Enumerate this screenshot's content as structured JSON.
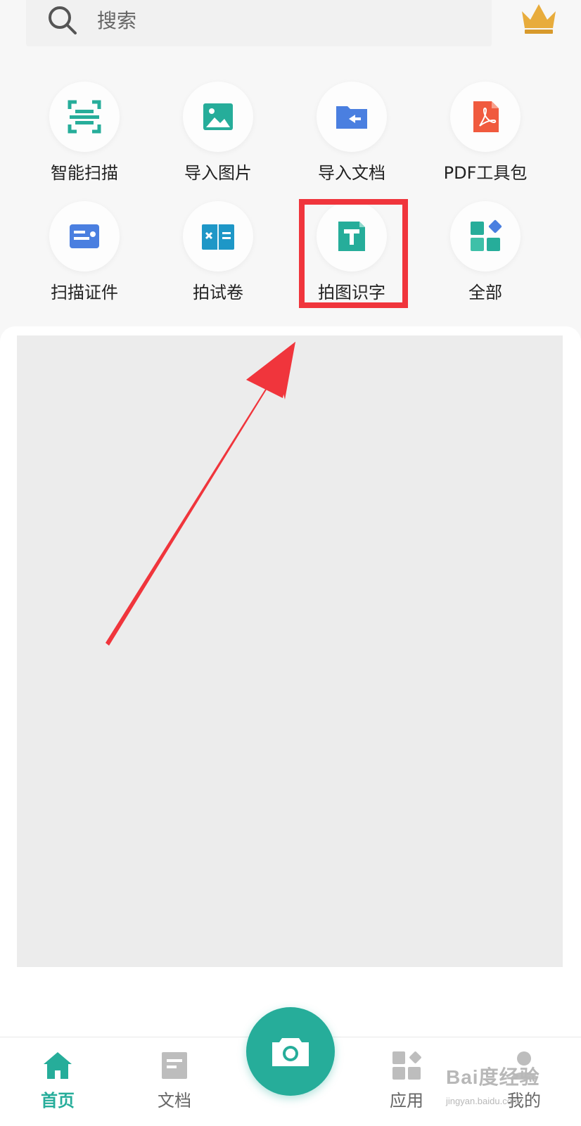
{
  "search": {
    "placeholder": "搜索"
  },
  "colors": {
    "accent": "#26ad9a",
    "highlight": "#f0353c"
  },
  "tools": [
    {
      "label": "智能扫描",
      "icon": "smart-scan-icon"
    },
    {
      "label": "导入图片",
      "icon": "import-image-icon"
    },
    {
      "label": "导入文档",
      "icon": "import-document-icon"
    },
    {
      "label": "PDF工具包",
      "icon": "pdf-toolkit-icon"
    },
    {
      "label": "扫描证件",
      "icon": "id-card-scan-icon"
    },
    {
      "label": "拍试卷",
      "icon": "exam-paper-icon"
    },
    {
      "label": "拍图识字",
      "icon": "text-recognition-icon"
    },
    {
      "label": "全部",
      "icon": "all-apps-icon"
    }
  ],
  "nav": {
    "home": "首页",
    "documents": "文档",
    "apps": "应用",
    "profile": "我的",
    "active": "home"
  },
  "watermark": {
    "brand": "Bai度经验",
    "url": "jingyan.baidu.com"
  }
}
